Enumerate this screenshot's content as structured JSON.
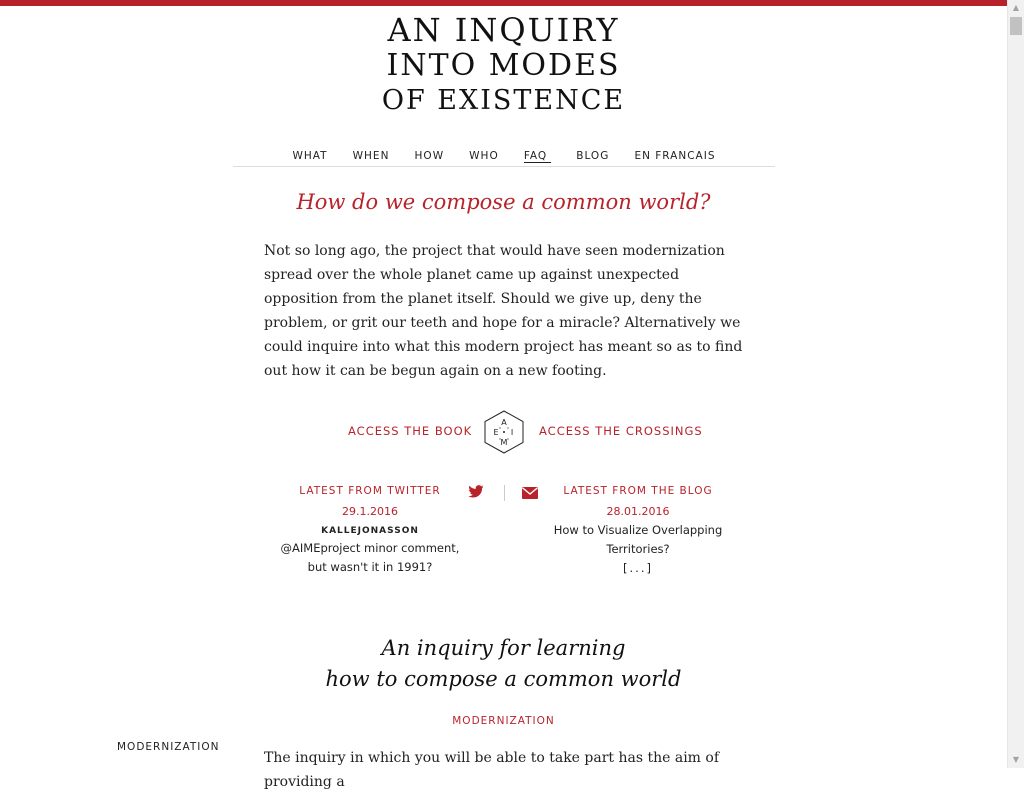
{
  "site": {
    "title_line1": "AN INQUIRY",
    "title_line2": "INTO MODES",
    "title_line3": "OF EXISTENCE",
    "accent_color": "#b8232b"
  },
  "nav": {
    "items": [
      "WHAT",
      "WHEN",
      "HOW",
      "WHO",
      "FAQ",
      "BLOG",
      "EN FRANCAIS"
    ]
  },
  "main": {
    "headline": "How do we compose a common world?",
    "intro": "Not so long ago, the project that would have seen modernization spread over the whole planet came up against unexpected opposition from the planet itself. Should we give up, deny the problem, or grit our teeth and hope for a miracle? Alternatively we could inquire into what this modern project has meant so as to find out how it can be begun again on a new footing.",
    "access_book": "ACCESS THE BOOK",
    "access_crossings": "ACCESS THE CROSSINGS",
    "logo_letters": [
      "A",
      "E",
      "I",
      "M"
    ]
  },
  "twitter": {
    "title": "LATEST FROM TWITTER",
    "date": "29.1.2016",
    "author": "KALLEJONASSON",
    "text_line1": "@AIMEproject minor comment,",
    "text_line2": "but wasn't it in 1991?",
    "icon": "twitter-icon"
  },
  "blog": {
    "title": "LATEST FROM THE BLOG",
    "date": "28.01.2016",
    "text_line1": "How to Visualize Overlapping",
    "text_line2": "Territories?",
    "more": "[...]",
    "icon": "mail-icon"
  },
  "section": {
    "heading_line1": "An inquiry for learning",
    "heading_line2": "how to compose a common world",
    "label": "MODERNIZATION",
    "side_label": "MODERNIZATION",
    "body_start": "The inquiry in which you will be able to take part has the aim of providing a"
  }
}
